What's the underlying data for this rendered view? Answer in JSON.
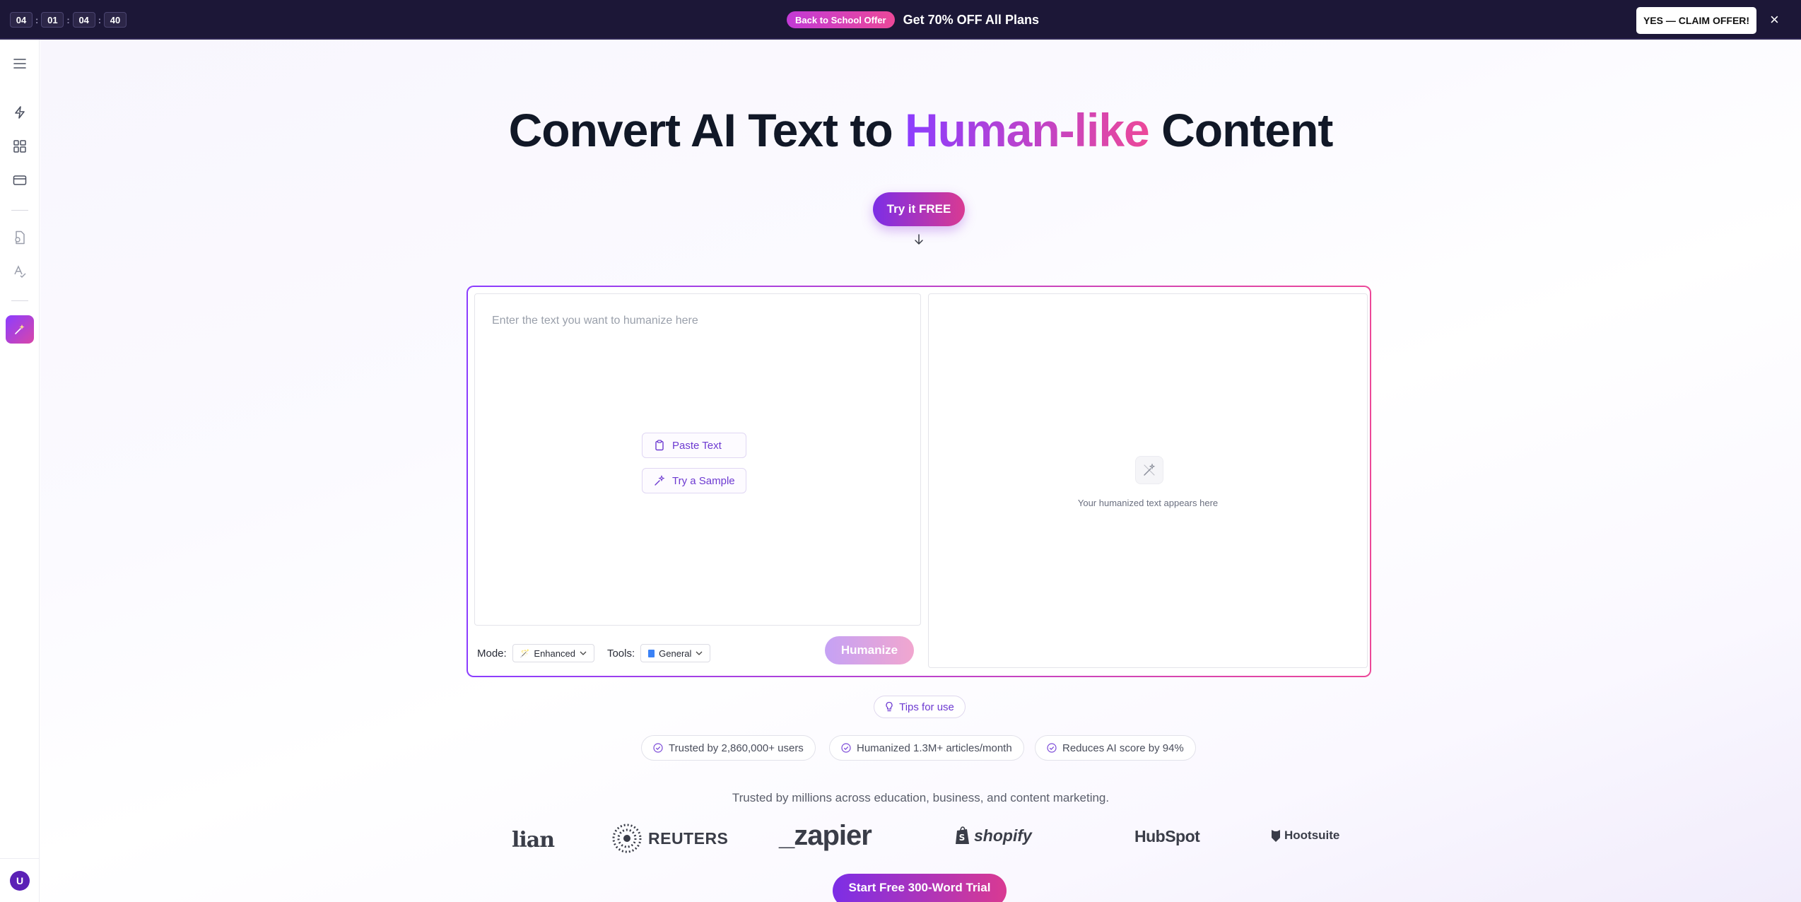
{
  "promo": {
    "countdown": [
      "04",
      "01",
      "04",
      "40"
    ],
    "separator": ":",
    "badge": "Back to School Offer",
    "text": "Get 70% OFF All Plans",
    "cta": "YES — CLAIM OFFER!",
    "close": "×"
  },
  "sidebar": {
    "items": [
      "menu-icon",
      "bolt-icon",
      "dashboard-icon",
      "card-icon",
      "document-icon",
      "text-check-icon",
      "sparkle-icon"
    ],
    "avatar_initial": "U"
  },
  "hero": {
    "title_part1": "Convert AI Text to ",
    "title_highlight": "Human-like",
    "title_part2": " Content",
    "try_button": "Try it FREE"
  },
  "editor": {
    "placeholder": "Enter the text you want to humanize here",
    "paste_button": "Paste Text",
    "sample_button": "Try a Sample",
    "output_placeholder": "Your humanized text appears here",
    "mode_label": "Mode:",
    "mode_value": "Enhanced",
    "tools_label": "Tools:",
    "tools_value": "General",
    "humanize_button": "Humanize"
  },
  "tips": "Tips for use",
  "stats": [
    "Trusted by 2,860,000+ users",
    "Humanized 1.3M+ articles/month",
    "Reduces AI score by 94%"
  ],
  "trusted_line": "Trusted by millions across education, business, and content marketing.",
  "logos": {
    "guardian": "lian",
    "reuters": "REUTERS",
    "zapier": "_zapier",
    "shopify": "shopify",
    "hubspot": "HubSpot",
    "hootsuite": "Hootsuite"
  },
  "bottom_cta": "Start Free 300-Word Trial",
  "colors": {
    "accent_start": "#8b3dff",
    "accent_end": "#ec4899",
    "banner_bg": "#1c1737"
  }
}
